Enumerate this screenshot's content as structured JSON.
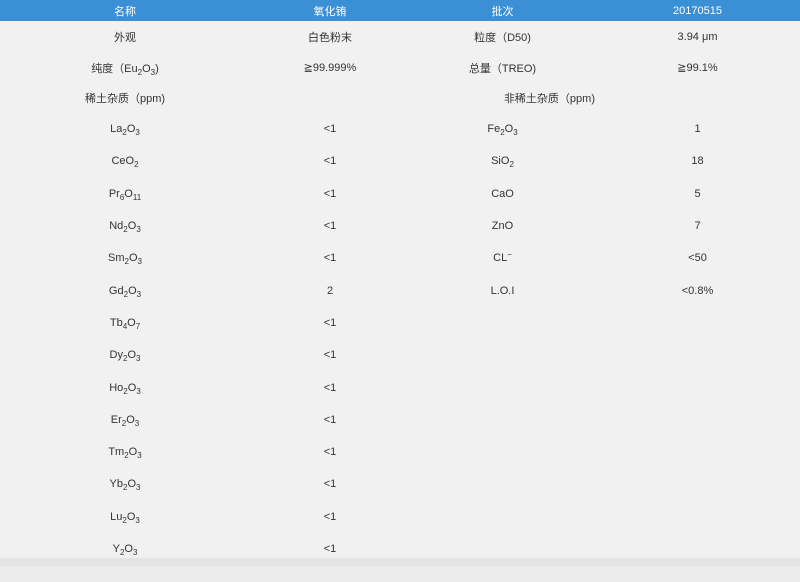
{
  "header": {
    "col1": "名称",
    "col2": "氧化铕",
    "col3": "批次",
    "col4": "20170515"
  },
  "info_rows": [
    {
      "label": "外观",
      "value": "白色粉末",
      "label2": "粒度（D50)",
      "value2": "3.94 μm"
    },
    {
      "label": "纯度（Eu2O3)",
      "value": "≧99.999%",
      "label2": "总量（TREO)",
      "value2": "≧99.1%"
    }
  ],
  "sections": {
    "rare_earth": "稀土杂质（ppm)",
    "non_rare_earth": "非稀土杂质（ppm)"
  },
  "rare_earth_impurities": [
    {
      "name": "La2O3",
      "value": "<1"
    },
    {
      "name": "CeO2",
      "value": "<1"
    },
    {
      "name": "Pr6O11",
      "value": "<1"
    },
    {
      "name": "Nd2O3",
      "value": "<1"
    },
    {
      "name": "Sm2O3",
      "value": "<1"
    },
    {
      "name": "Gd2O3",
      "value": "2"
    },
    {
      "name": "Tb4O7",
      "value": "<1"
    },
    {
      "name": "Dy2O3",
      "value": "<1"
    },
    {
      "name": "Ho2O3",
      "value": "<1"
    },
    {
      "name": "Er2O3",
      "value": "<1"
    },
    {
      "name": "Tm2O3",
      "value": "<1"
    },
    {
      "name": "Yb2O3",
      "value": "<1"
    },
    {
      "name": "Lu2O3",
      "value": "<1"
    },
    {
      "name": "Y2O3",
      "value": "<1"
    }
  ],
  "non_rare_earth_impurities": [
    {
      "name": "Fe2O3",
      "value": "1"
    },
    {
      "name": "SiO2",
      "value": "18"
    },
    {
      "name": "CaO",
      "value": "5"
    },
    {
      "name": "ZnO",
      "value": "7"
    },
    {
      "name": "CL-",
      "value": "<50"
    },
    {
      "name": "L.O.I",
      "value": "<0.8%"
    }
  ]
}
